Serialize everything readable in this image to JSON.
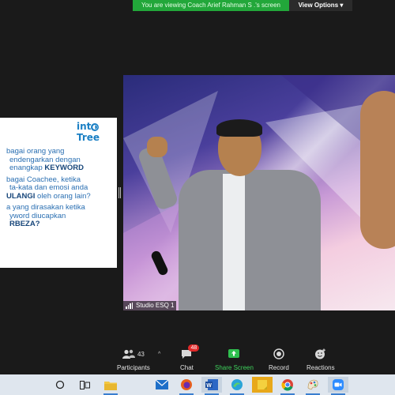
{
  "banner": {
    "text": "You are viewing Coach Arief Rahman S .'s screen",
    "view_options": "View Options ▾",
    "color": "#22a73a"
  },
  "slide": {
    "logo": "intreeTree",
    "logo_prefix": "int",
    "logo_suffix": "Tree",
    "lines": [
      "bagai orang yang",
      "endengarkan dengan",
      "enangkap ",
      "bagai Coachee, ketika",
      "ta-kata dan emosi anda",
      "ULANGI",
      "a yang dirasakan ketika",
      "yword diucapkan",
      "RBEZA?"
    ],
    "keyword": "KEYWORD",
    "line6_rest": " oleh orang lain?"
  },
  "video": {
    "label": "Studio ESQ 1"
  },
  "controls": {
    "participants_label": "Participants",
    "participants_count": "43",
    "chat_label": "Chat",
    "chat_badge": "48",
    "share_label": "Share Screen",
    "record_label": "Record",
    "reactions_label": "Reactions",
    "share_color": "#3ed25c"
  },
  "taskbar": {
    "icons": [
      "search-circle-icon",
      "task-view-icon",
      "file-explorer-icon",
      "mail-icon",
      "firefox-icon",
      "word-icon",
      "edge-icon",
      "sticky-notes-icon",
      "chrome-icon",
      "paint-icon",
      "zoom-icon"
    ]
  }
}
